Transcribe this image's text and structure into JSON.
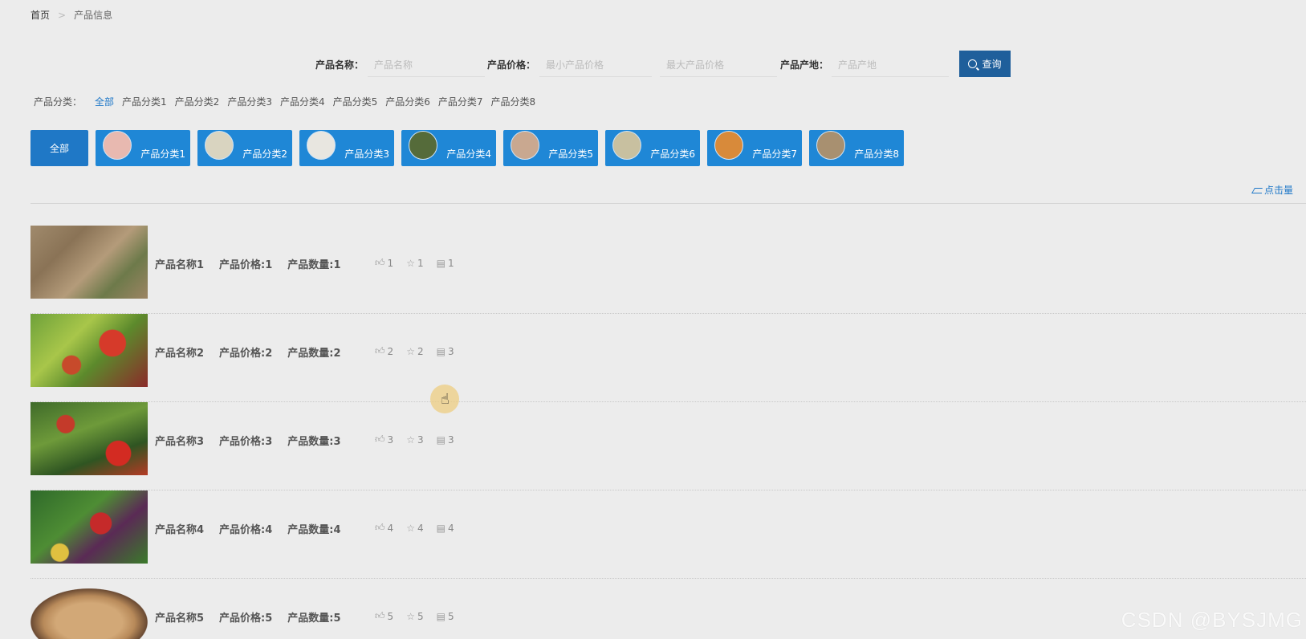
{
  "breadcrumb": {
    "home": "首页",
    "separator": ">",
    "current": "产品信息"
  },
  "search": {
    "name_label": "产品名称：",
    "name_placeholder": "产品名称",
    "price_label": "产品价格：",
    "min_price_placeholder": "最小产品价格",
    "max_price_placeholder": "最大产品价格",
    "origin_label": "产品产地：",
    "origin_placeholder": "产品产地",
    "button_label": "查询"
  },
  "category_filter": {
    "label": "产品分类：",
    "options": [
      "全部",
      "产品分类1",
      "产品分类2",
      "产品分类3",
      "产品分类4",
      "产品分类5",
      "产品分类6",
      "产品分类7",
      "产品分类8"
    ]
  },
  "category_tiles": {
    "all": "全部",
    "items": [
      "产品分类1",
      "产品分类2",
      "产品分类3",
      "产品分类4",
      "产品分类5",
      "产品分类6",
      "产品分类7",
      "产品分类8"
    ],
    "thumb_colors": [
      "#e8b9b0",
      "#d9d4c0",
      "#e8e6e0",
      "#556b3a",
      "#c9a890",
      "#c8c0a0",
      "#d88a3a",
      "#a89070"
    ]
  },
  "sort_link": "点击量",
  "products": [
    {
      "name": "产品名称1",
      "price": "产品价格:1",
      "qty": "产品数量:1",
      "likes": "1",
      "favs": "1",
      "comments": "1"
    },
    {
      "name": "产品名称2",
      "price": "产品价格:2",
      "qty": "产品数量:2",
      "likes": "2",
      "favs": "2",
      "comments": "3"
    },
    {
      "name": "产品名称3",
      "price": "产品价格:3",
      "qty": "产品数量:3",
      "likes": "3",
      "favs": "3",
      "comments": "3"
    },
    {
      "name": "产品名称4",
      "price": "产品价格:4",
      "qty": "产品数量:4",
      "likes": "4",
      "favs": "4",
      "comments": "4"
    },
    {
      "name": "产品名称5",
      "price": "产品价格:5",
      "qty": "产品数量:5",
      "likes": "5",
      "favs": "5",
      "comments": "5"
    }
  ],
  "icons": {
    "like": "thumbs-up-icon",
    "fav": "star-icon",
    "comment": "comment-icon",
    "search": "search-icon",
    "trend": "trend-icon"
  },
  "colors": {
    "accent": "#1f87d6",
    "button": "#1f5f9b",
    "link": "#1f78c8",
    "background": "#ececec"
  },
  "watermark": "CSDN @BYSJMG"
}
